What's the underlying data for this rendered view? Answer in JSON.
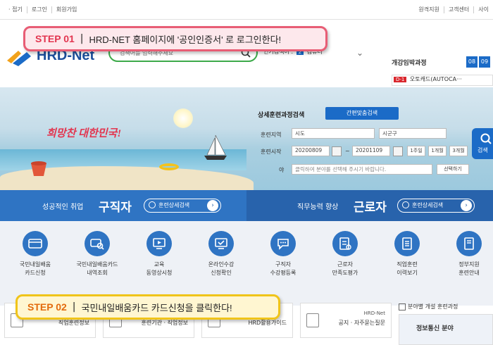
{
  "topbar": {
    "left": [
      "· 접기",
      "로그인",
      "회원가입"
    ],
    "right": [
      "원격지원",
      "고객센터",
      "사이"
    ]
  },
  "header": {
    "logo_text": "HRD-Net",
    "search_placeholder": "검색어를 입력해주세요",
    "popular_label": "인기검색어 :",
    "popular_rank": "2",
    "popular_word": "컴퓨터",
    "course_title": "개강임박과정",
    "course_day1": "08",
    "course_day2": "09",
    "course_badge": "D-1",
    "course_name": "오토캐드(AUTOCA···"
  },
  "step1": {
    "step": "STEP 01",
    "sep": "|",
    "message": "HRD-NET 홈페이지에 '공인인증서' 로 로그인한다!"
  },
  "hero": {
    "slogan": "희망찬 대한민국!",
    "search_title": "상세훈련과정검색",
    "quick_button": "간편맞춤검색",
    "region_label": "훈련지역",
    "region_value": "시도",
    "district_value": "시군구",
    "start_label": "훈련시작",
    "date_from": "20200809",
    "date_sep": "~",
    "date_to": "20201109",
    "period_buttons": [
      "1주일",
      "1개월",
      "3개월"
    ],
    "field_label": "야",
    "field_placeholder": "클릭하여 분야를 선택해 주시기 바랍니다.",
    "field_button": "선택하기",
    "search_button": "검색"
  },
  "bands": [
    {
      "label": "성공적인 취업",
      "big": "구직자",
      "button": "훈련상세검색"
    },
    {
      "label": "직무능력 향상",
      "big": "근로자",
      "button": "훈련상세검색"
    }
  ],
  "menu": [
    {
      "line1": "국민내일배움",
      "line2": "카드신청",
      "icon": "card-icon"
    },
    {
      "line1": "국민내일배움카드",
      "line2": "내역조회",
      "icon": "card-search-icon"
    },
    {
      "line1": "교육",
      "line2": "동영상시청",
      "icon": "video-icon"
    },
    {
      "line1": "온라인수강",
      "line2": "신청확인",
      "icon": "monitor-check-icon"
    },
    {
      "line1": "구직자",
      "line2": "수강평등록",
      "icon": "chat-icon"
    },
    {
      "line1": "근로자",
      "line2": "만족도평가",
      "icon": "survey-icon"
    },
    {
      "line1": "직업훈련",
      "line2": "이력보기",
      "icon": "list-icon"
    },
    {
      "line1": "정부지원",
      "line2": "훈련안내",
      "icon": "book-icon"
    }
  ],
  "step2": {
    "step": "STEP 02",
    "sep": "|",
    "message": "국민내일배움카드 카드신청을 클릭한다!"
  },
  "cards": [
    {
      "sub": "",
      "title": "직업훈련정보"
    },
    {
      "sub": "",
      "title": "훈련기관 · 직업정보"
    },
    {
      "sub": "",
      "title": "HRD활용가이드"
    },
    {
      "sub": "HRD-Net",
      "title": "공지 · 자주묻는질문"
    }
  ],
  "side": {
    "heading": "분야별 개설 훈련과정",
    "field": "정보통신 분야"
  },
  "colors": {
    "primary": "#1b6bc7",
    "band1": "#2f74c3",
    "band2": "#2863ac",
    "search_border": "#3daa4a",
    "step1_border": "#e85d75",
    "step2_border": "#f0c419"
  }
}
